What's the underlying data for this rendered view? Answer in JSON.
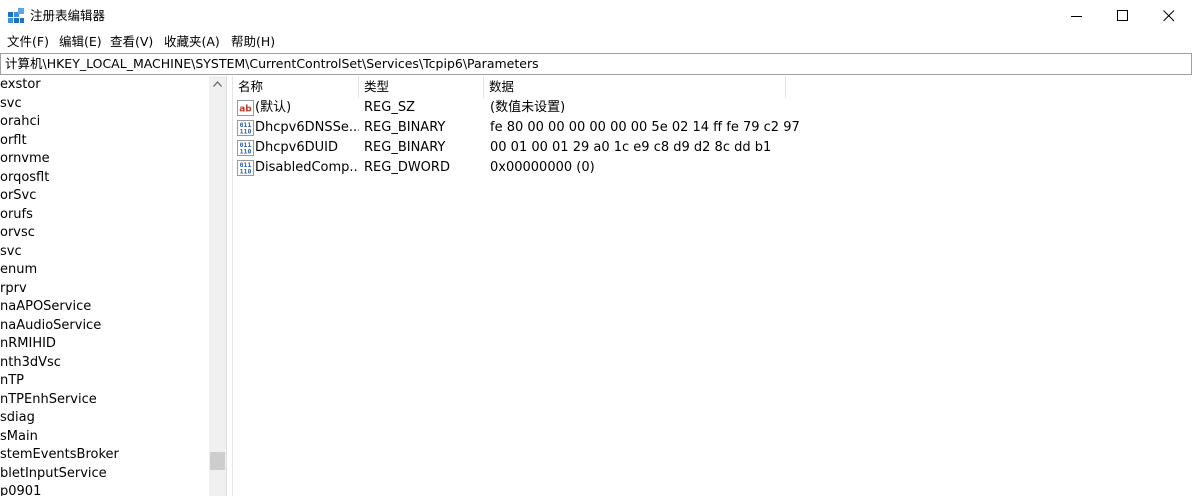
{
  "window": {
    "title": "注册表编辑器"
  },
  "menu": [
    "文件(F)",
    "编辑(E)",
    "查看(V)",
    "收藏夹(A)",
    "帮助(H)"
  ],
  "address": "计算机\\HKEY_LOCAL_MACHINE\\SYSTEM\\CurrentControlSet\\Services\\Tcpip6\\Parameters",
  "tree": [
    "exstor",
    "svc",
    "orahci",
    "orflt",
    "ornvme",
    "orqosflt",
    "orSvc",
    "orufs",
    "orvsc",
    "svc",
    "enum",
    "rprv",
    "naAPOService",
    "naAudioService",
    "nRMIHID",
    "nth3dVsc",
    "nTP",
    "nTPEnhService",
    "sdiag",
    "sMain",
    "stemEventsBroker",
    "bletInputService",
    "p0901"
  ],
  "list": {
    "columns": {
      "name": "名称",
      "type": "类型",
      "data": "数据"
    },
    "rows": [
      {
        "icon": "string-value-icon",
        "name": "(默认)",
        "type": "REG_SZ",
        "data": "(数值未设置)"
      },
      {
        "icon": "binary-value-icon",
        "name": "Dhcpv6DNSSe...",
        "type": "REG_BINARY",
        "data": "fe 80 00 00 00 00 00 00 5e 02 14 ff fe 79 c2 97"
      },
      {
        "icon": "binary-value-icon",
        "name": "Dhcpv6DUID",
        "type": "REG_BINARY",
        "data": "00 01 00 01 29 a0 1c e9 c8 d9 d2 8c dd b1"
      },
      {
        "icon": "binary-value-icon",
        "name": "DisabledComp...",
        "type": "REG_DWORD",
        "data": "0x00000000 (0)"
      }
    ]
  },
  "colors": {
    "string_icon": "#c0392b",
    "binary_icon": "#2b5fb3",
    "app_icon": "#1e6fc8"
  }
}
